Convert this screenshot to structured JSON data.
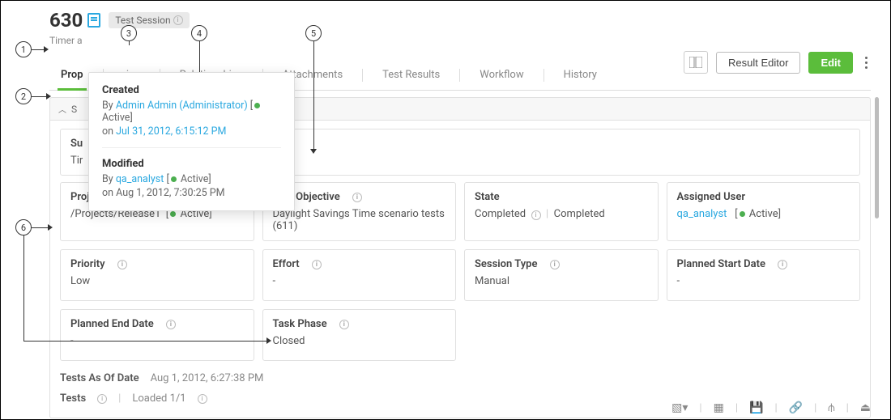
{
  "header": {
    "id": "630",
    "type_chip": "Test Session",
    "subtitle_prefix": "Timer a"
  },
  "toolbar": {
    "result_editor": "Result Editor",
    "edit": "Edit"
  },
  "tabs": [
    "Prop",
    "rics",
    "Relationships",
    "Attachments",
    "Test Results",
    "Workflow",
    "History"
  ],
  "section_header": "S",
  "summary": {
    "label_prefix": "Su",
    "value_prefix": "Tir"
  },
  "popover": {
    "created_title": "Created",
    "created_by_prefix": "By ",
    "created_user": "Admin Admin (Administrator)",
    "created_status": "Active",
    "created_on_prefix": "on ",
    "created_on": "Jul 31, 2012, 6:15:12 PM",
    "modified_title": "Modified",
    "modified_by_prefix": "By ",
    "modified_user": "qa_analyst",
    "modified_status": "Active",
    "modified_on_prefix": "on ",
    "modified_on": "Aug 1, 2012, 7:30:25 PM"
  },
  "fields": {
    "project": {
      "label": "Project",
      "value": "/Projects/Release1",
      "status": "Active"
    },
    "objective": {
      "label": "Test Objective",
      "value": "Daylight Savings Time scenario tests (611)"
    },
    "state": {
      "label": "State",
      "value1": "Completed",
      "value2": "Completed"
    },
    "assigned": {
      "label": "Assigned User",
      "value": "qa_analyst",
      "status": "Active"
    },
    "priority": {
      "label": "Priority",
      "value": "Low"
    },
    "effort": {
      "label": "Effort",
      "value": "-"
    },
    "session_type": {
      "label": "Session Type",
      "value": "Manual"
    },
    "planned_start": {
      "label": "Planned Start Date",
      "value": "-"
    },
    "planned_end": {
      "label": "Planned End Date",
      "value": "-"
    },
    "task_phase": {
      "label": "Task Phase",
      "value": "Closed"
    }
  },
  "tests_as_of": {
    "label": "Tests As Of Date",
    "value": "Aug 1, 2012, 6:27:38 PM"
  },
  "tests_row": {
    "label": "Tests",
    "loaded": "Loaded 1/1"
  },
  "annotations": {
    "a1": "1",
    "a2": "2",
    "a3": "3",
    "a4": "4",
    "a5": "5",
    "a6": "6"
  }
}
